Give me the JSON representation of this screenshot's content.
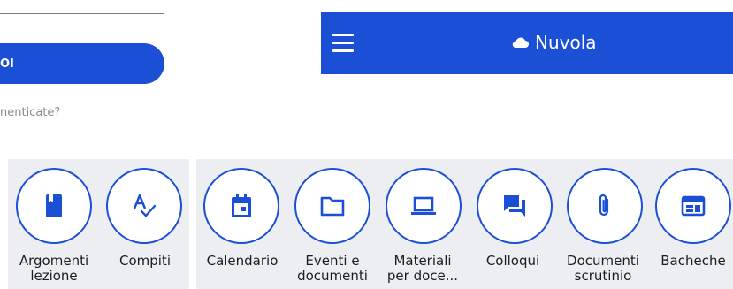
{
  "login": {
    "button_label": "OI",
    "forgot_text": "nenticate?"
  },
  "topbar": {
    "title": "Nuvola",
    "menu_icon": "hamburger-menu-icon",
    "brand_icon": "cloud-icon"
  },
  "tiles": [
    {
      "label": "Argomenti\nlezione",
      "icon": "book-icon"
    },
    {
      "label": "Compiti",
      "icon": "spellcheck-icon"
    },
    {
      "label": "Calendario",
      "icon": "calendar-icon"
    },
    {
      "label": "Eventi e\ndocumenti",
      "icon": "folder-icon"
    },
    {
      "label": "Materiali\nper doce...",
      "icon": "laptop-icon"
    },
    {
      "label": "Colloqui",
      "icon": "chat-icon"
    },
    {
      "label": "Documenti\nscrutinio",
      "icon": "paperclip-icon"
    },
    {
      "label": "Bacheche",
      "icon": "board-icon"
    }
  ],
  "colors": {
    "accent": "#1a4fd6",
    "panel_bg": "#eceef1"
  }
}
